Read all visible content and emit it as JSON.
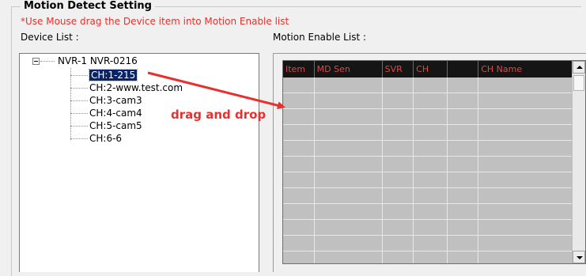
{
  "section": {
    "title": "Motion Detect Setting",
    "instruction": "*Use Mouse drag the Device item into Motion Enable list"
  },
  "device_list": {
    "label": "Device List :",
    "root": "NVR-1 NVR-0216",
    "items": [
      "CH:1-215",
      "CH:2-www.test.com",
      "CH:3-cam3",
      "CH:4-cam4",
      "CH:5-cam5",
      "CH:6-6"
    ],
    "selected_index": 0
  },
  "motion_list": {
    "label": "Motion Enable List :",
    "columns": [
      "Item",
      "MD Sen",
      "SVR",
      "CH",
      "",
      "CH Name"
    ],
    "rows": []
  },
  "annotation": {
    "text": "drag and drop",
    "color": "#e8302c"
  },
  "colors": {
    "header_bg": "#151515",
    "header_text": "#d74a4a",
    "selection": "#0a246a"
  }
}
